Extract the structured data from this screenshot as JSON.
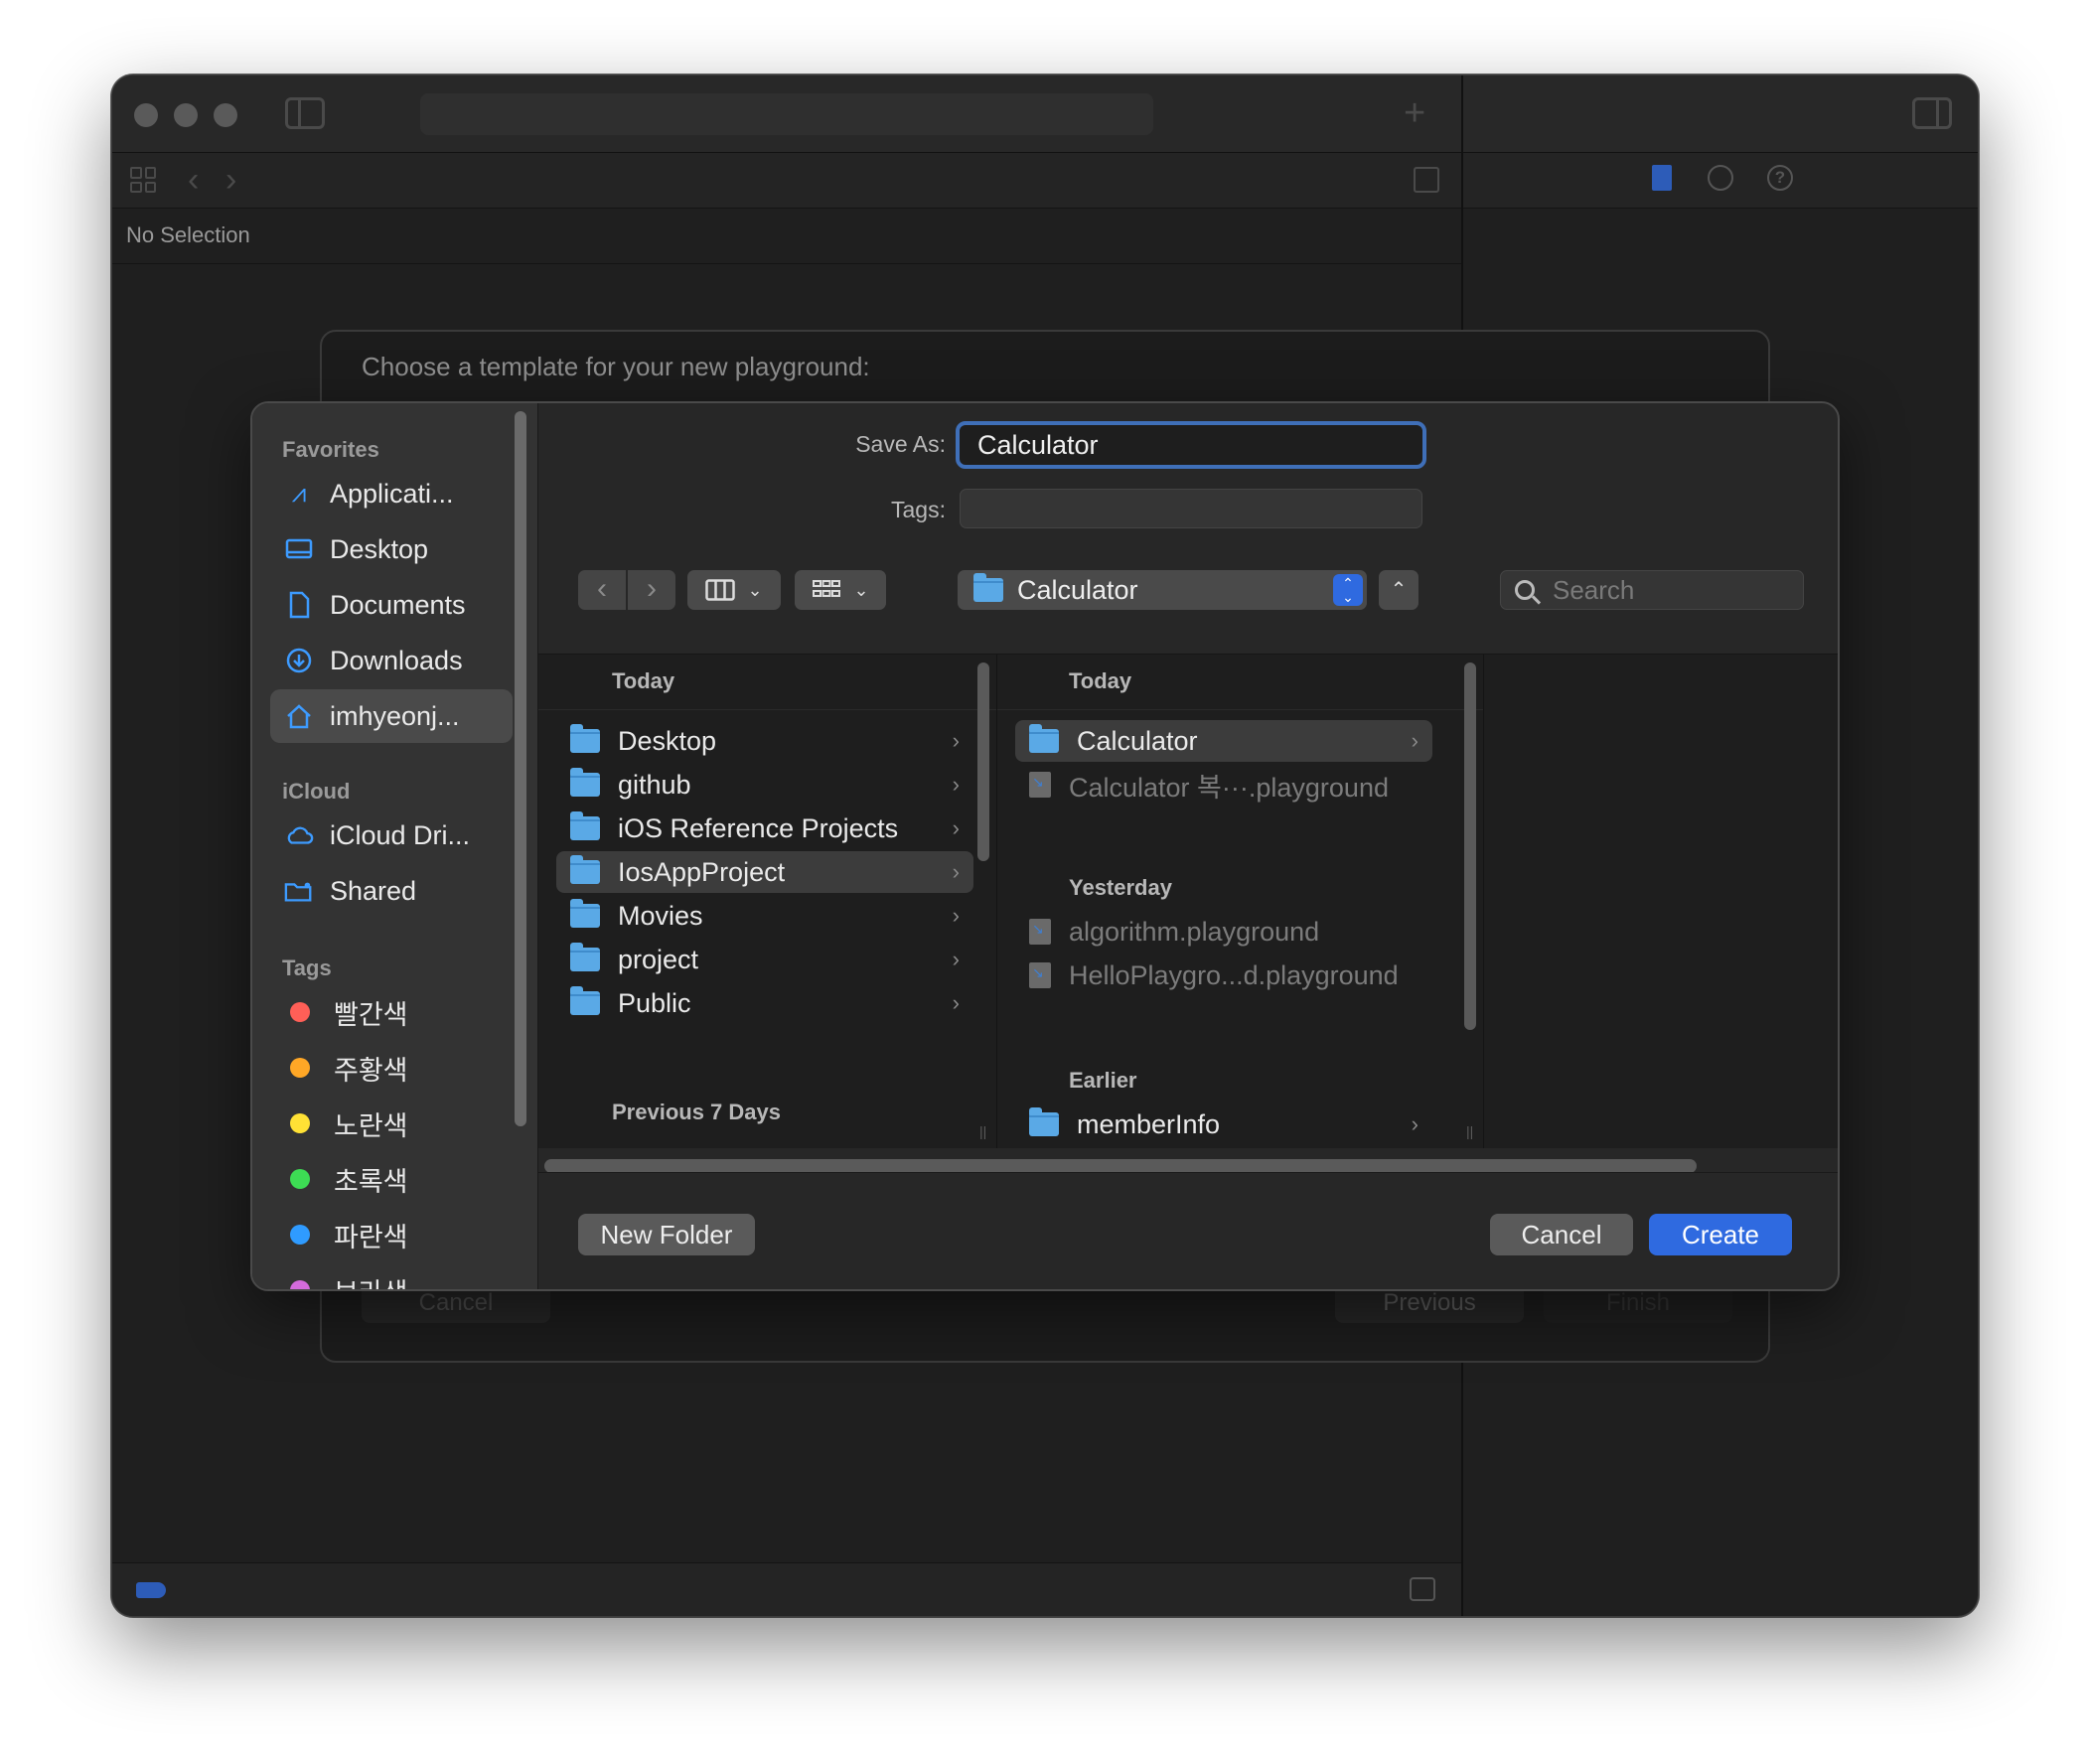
{
  "window": {
    "status": "No Selection"
  },
  "template_sheet": {
    "prompt": "Choose a template for your new playground:",
    "cancel_label": "Cancel",
    "previous_label": "Previous",
    "finish_label": "Finish"
  },
  "save_dialog": {
    "save_as_label": "Save As:",
    "save_as_value": "Calculator",
    "tags_label": "Tags:",
    "location": "Calculator",
    "search_placeholder": "Search",
    "sidebar": {
      "favorites_title": "Favorites",
      "favorites": [
        {
          "label": "Applicati...",
          "icon": "applications-icon"
        },
        {
          "label": "Desktop",
          "icon": "desktop-icon"
        },
        {
          "label": "Documents",
          "icon": "document-icon"
        },
        {
          "label": "Downloads",
          "icon": "downloads-icon"
        },
        {
          "label": "imhyeonj...",
          "icon": "home-icon",
          "selected": true
        }
      ],
      "icloud_title": "iCloud",
      "icloud": [
        {
          "label": "iCloud Dri...",
          "icon": "cloud-icon"
        },
        {
          "label": "Shared",
          "icon": "shared-folder-icon"
        }
      ],
      "tags_title": "Tags",
      "tags": [
        {
          "label": "빨간색",
          "color": "#ff5f57"
        },
        {
          "label": "주황색",
          "color": "#ffa726"
        },
        {
          "label": "노란색",
          "color": "#ffe135"
        },
        {
          "label": "초록색",
          "color": "#3ddc54"
        },
        {
          "label": "파란색",
          "color": "#2f9bff"
        },
        {
          "label": "보라색",
          "color": "#d46bdc"
        }
      ]
    },
    "column1": {
      "section_today": "Today",
      "items": [
        {
          "label": "Desktop"
        },
        {
          "label": "github"
        },
        {
          "label": "iOS Reference Projects"
        },
        {
          "label": "IosAppProject",
          "selected": true
        },
        {
          "label": "Movies"
        },
        {
          "label": "project"
        },
        {
          "label": "Public"
        }
      ],
      "section_previous": "Previous 7 Days"
    },
    "column2": {
      "section_today": "Today",
      "today_items": [
        {
          "label": "Calculator",
          "type": "folder",
          "selected": true
        },
        {
          "label": "Calculator 복···.playground",
          "type": "playground"
        }
      ],
      "section_yesterday": "Yesterday",
      "yesterday_items": [
        {
          "label": "algorithm.playground",
          "type": "playground"
        },
        {
          "label": "HelloPlaygro...d.playground",
          "type": "playground"
        }
      ],
      "section_earlier": "Earlier",
      "earlier_items": [
        {
          "label": "memberInfo",
          "type": "folder"
        }
      ]
    },
    "buttons": {
      "new_folder": "New Folder",
      "cancel": "Cancel",
      "create": "Create"
    },
    "accent_color": "#2f6ae0"
  }
}
